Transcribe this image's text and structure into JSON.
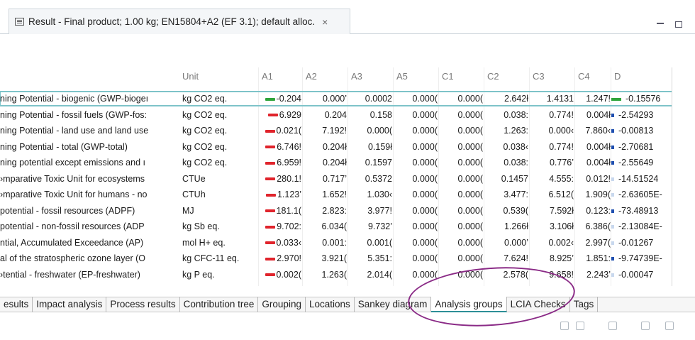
{
  "editor_tab": {
    "title": "Result - Final product; 1.00 kg; EN15804+A2 (EF 3.1); default alloc.",
    "close": "×"
  },
  "window": {
    "minimize": "–",
    "maximize": "□"
  },
  "table": {
    "headers": [
      "Unit",
      "A1",
      "A2",
      "A3",
      "A5",
      "C1",
      "C2",
      "C3",
      "C4",
      "D"
    ],
    "rows": [
      {
        "category": "ning Potential - biogenic (GWP-biogeı",
        "unit": "kg CO2 eq.",
        "a1": "-0.204",
        "a2": "0.000’",
        "a3": "0.0002",
        "a5": "0.000(",
        "c1": "0.000(",
        "c2": "2.642ł",
        "c3": "1.4131",
        "c4": "1.247!",
        "d": "-0.15576",
        "a1_color": "#2ea43a",
        "d_color": "#2ea43a"
      },
      {
        "category": "ning Potential - fossil fuels (GWP-fos:",
        "unit": "kg CO2 eq.",
        "a1": "6.929",
        "a2": "0.204",
        "a3": "0.158",
        "a5": "0.000(",
        "c1": "0.000(",
        "c2": "0.038:",
        "c3": "0.774!",
        "c4": "0.004ł",
        "d": "-2.54293",
        "a1_color": "#e0242c",
        "d_color": "#1f4fb0"
      },
      {
        "category": "ning Potential - land use and land use",
        "unit": "kg CO2 eq.",
        "a1": "0.021(",
        "a2": "7.192!",
        "a3": "0.000(",
        "a5": "0.000(",
        "c1": "0.000(",
        "c2": "1.263:",
        "c3": "0.000‹",
        "c4": "7.860‹",
        "d": "-0.00813",
        "a1_color": "#e0242c",
        "d_color": "#1f4fb0"
      },
      {
        "category": "ning Potential - total (GWP-total)",
        "unit": "kg CO2 eq.",
        "a1": "6.746!",
        "a2": "0.204ł",
        "a3": "0.159ł",
        "a5": "0.000(",
        "c1": "0.000(",
        "c2": "0.038‹",
        "c3": "0.774!",
        "c4": "0.004ł",
        "d": "-2.70681",
        "a1_color": "#e0242c",
        "d_color": "#1f4fb0"
      },
      {
        "category": "ning potential except emissions and ı",
        "unit": "kg CO2 eq.",
        "a1": "6.959!",
        "a2": "0.204ł",
        "a3": "0.1597",
        "a5": "0.000(",
        "c1": "0.000(",
        "c2": "0.038:",
        "c3": "0.776’",
        "c4": "0.004ł",
        "d": "-2.55649",
        "a1_color": "#e0242c",
        "d_color": "#1f4fb0"
      },
      {
        "category": "›mparative Toxic Unit for ecosystems",
        "unit": "CTUe",
        "a1": "280.1!",
        "a2": "0.717’",
        "a3": "0.5372",
        "a5": "0.000(",
        "c1": "0.000(",
        "c2": "0.1457",
        "c3": "4.555:",
        "c4": "0.012!",
        "d": "-14.51524",
        "a1_color": "#e0242c",
        "d_color": "#c8d8ee"
      },
      {
        "category": "›mparative Toxic Unit for humans - no",
        "unit": "CTUh",
        "a1": "1.123’",
        "a2": "1.652!",
        "a3": "1.030‹",
        "a5": "0.000(",
        "c1": "0.000(",
        "c2": "3.477:",
        "c3": "6.512(",
        "c4": "1.909(",
        "d": "-2.63605E-",
        "a1_color": "#e0242c",
        "d_color": "#c8d8ee"
      },
      {
        "category": "potential - fossil resources (ADPF)",
        "unit": "MJ",
        "a1": "181.1(",
        "a2": "2.823:",
        "a3": "3.977!",
        "a5": "0.000(",
        "c1": "0.000(",
        "c2": "0.539(",
        "c3": "7.592ł",
        "c4": "0.123:",
        "d": "-73.48913",
        "a1_color": "#e0242c",
        "d_color": "#1f4fb0"
      },
      {
        "category": "potential - non-fossil resources (ADP",
        "unit": "kg Sb eq.",
        "a1": "9.702:",
        "a2": "6.034(",
        "a3": "9.732’",
        "a5": "0.000(",
        "c1": "0.000(",
        "c2": "1.266ł",
        "c3": "3.106ł",
        "c4": "6.386(",
        "d": "-2.13084E-",
        "a1_color": "#e0242c",
        "d_color": "#c8d8ee"
      },
      {
        "category": "ntial, Accumulated Exceedance (AP)",
        "unit": "mol H+ eq.",
        "a1": "0.033‹",
        "a2": "0.001:",
        "a3": "0.001(",
        "a5": "0.000(",
        "c1": "0.000(",
        "c2": "0.000’",
        "c3": "0.002‹",
        "c4": "2.997(",
        "d": "-0.01267",
        "a1_color": "#e0242c",
        "d_color": "#c8d8ee"
      },
      {
        "category": "al of the stratospheric ozone layer (O",
        "unit": "kg CFC-11 eq.",
        "a1": "2.970!",
        "a2": "3.921(",
        "a3": "5.351:",
        "a5": "0.000(",
        "c1": "0.000(",
        "c2": "7.624!",
        "c3": "8.925’",
        "c4": "1.851:",
        "d": "-9.74739E-",
        "a1_color": "#e0242c",
        "d_color": "#1f4fb0"
      },
      {
        "category": "›tential - freshwater (EP-freshwater)",
        "unit": "kg P eq.",
        "a1": "0.002(",
        "a2": "1.263(",
        "a3": "2.014(",
        "a5": "0.000(",
        "c1": "0.000(",
        "c2": "2.578(",
        "c3": "9.658!",
        "c4": "2.243’",
        "d": "-0.00047",
        "a1_color": "#e0242c",
        "d_color": "#c8d8ee"
      }
    ]
  },
  "bottom_tabs": [
    "esults",
    "Impact analysis",
    "Process results",
    "Contribution tree",
    "Grouping",
    "Locations",
    "Sankey diagram",
    "Analysis groups",
    "LCIA Checks",
    "Tags"
  ],
  "active_bottom_tab": "Analysis groups",
  "annotation_color": "#8a2a86"
}
